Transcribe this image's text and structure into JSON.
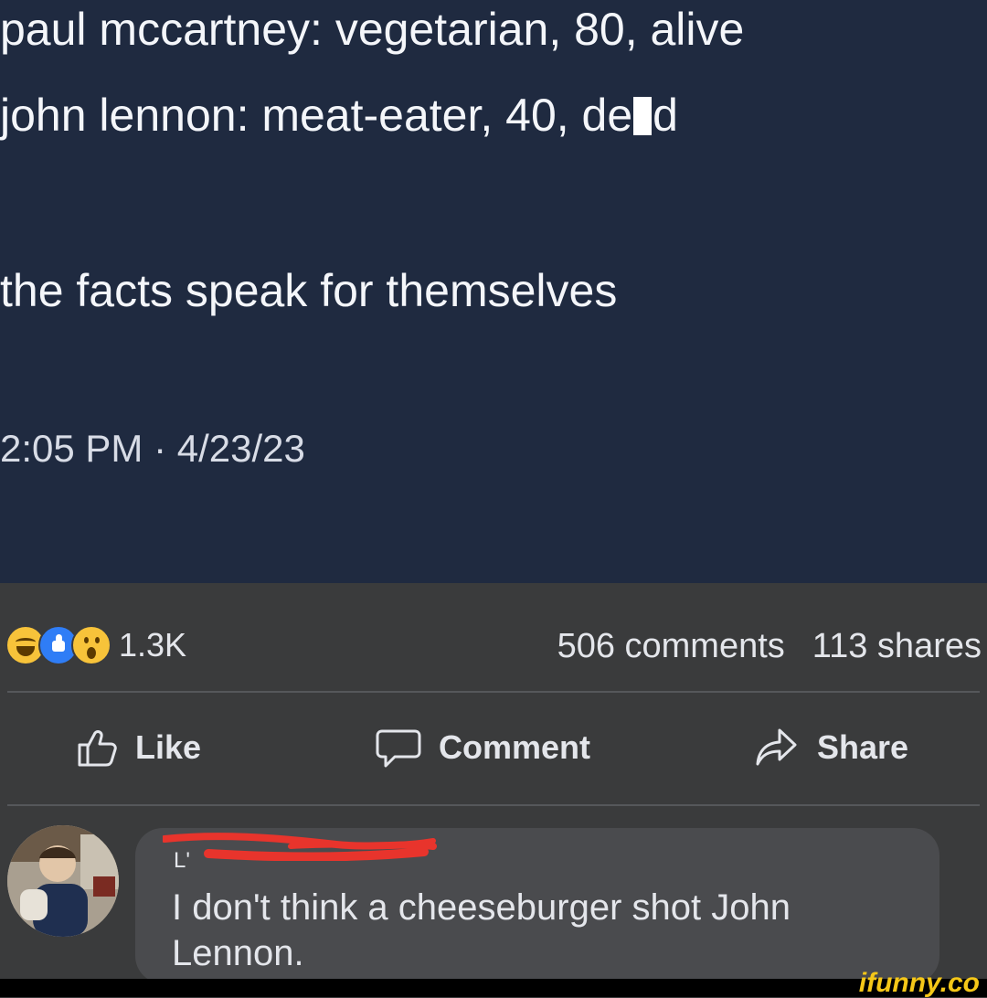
{
  "post": {
    "line1": "paul mccartney: vegetarian, 80, alive",
    "line2_start": "john lennon: meat-eater, 40, de",
    "line2_end": "d",
    "line3": "the facts speak for themselves",
    "timestamp": "2:05 PM · 4/23/23"
  },
  "engagement": {
    "reactions": [
      "haha-emoji",
      "like-emoji",
      "wow-emoji"
    ],
    "reaction_count": "1.3K",
    "comments": "506 comments",
    "shares": "113 shares"
  },
  "actions": {
    "like": "Like",
    "comment": "Comment",
    "share": "Share",
    "icons": [
      "thumbs-up-icon",
      "speech-bubble-icon",
      "share-arrow-icon"
    ]
  },
  "comment": {
    "name_fragment": "L'",
    "text": "I don't think a cheeseburger shot John Lennon."
  },
  "watermark": "ifunny.co",
  "colors": {
    "post_background": "#1f2a40",
    "facebook_background": "#3a3b3c",
    "bubble": "#4a4b4e",
    "redaction": "#e8342c",
    "watermark": "#f5c718"
  }
}
